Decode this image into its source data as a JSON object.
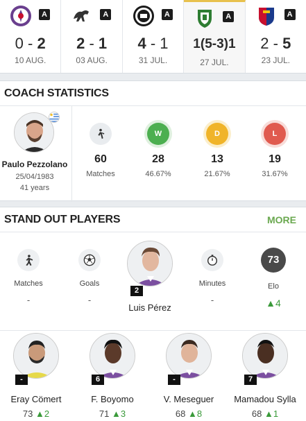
{
  "matches": [
    {
      "badge": "A",
      "score_left": "0",
      "score_right": "2",
      "bold_right": true,
      "date": "10 AUG."
    },
    {
      "badge": "A",
      "score_left": "2",
      "score_right": "1",
      "bold_right": false,
      "date": "03 AUG."
    },
    {
      "badge": "A",
      "score_left": "4",
      "score_right": "1",
      "bold_right": false,
      "date": "31 JUL."
    },
    {
      "badge": "A",
      "score_text": "1(5-3)1",
      "date": "27 JUL."
    },
    {
      "badge": "A",
      "score_left": "2",
      "score_right": "5",
      "bold_right": true,
      "date": "23 JUL."
    }
  ],
  "coach": {
    "section_title": "COACH STATISTICS",
    "name": "Paulo Pezzolano",
    "dob": "25/04/1983",
    "age": "41 years",
    "stats": [
      {
        "icon": "whistle-icon",
        "letter": "",
        "value": "60",
        "sub": "Matches",
        "color": "#e9ecef"
      },
      {
        "icon": "win-icon",
        "letter": "W",
        "value": "28",
        "sub": "46.67%",
        "color": "#4caf50"
      },
      {
        "icon": "draw-icon",
        "letter": "D",
        "value": "13",
        "sub": "21.67%",
        "color": "#f0b429"
      },
      {
        "icon": "loss-icon",
        "letter": "L",
        "value": "19",
        "sub": "31.67%",
        "color": "#e05a4f"
      }
    ]
  },
  "standout": {
    "section_title": "STAND OUT PLAYERS",
    "more_label": "MORE",
    "key": [
      {
        "label": "Matches",
        "value": "-"
      },
      {
        "label": "Goals",
        "value": "-"
      },
      {
        "label": "Minutes",
        "value": "-"
      },
      {
        "label": "Elo",
        "badge": "73",
        "value": "4"
      }
    ],
    "featured": {
      "number": "2",
      "name": "Luis Pérez"
    },
    "players": [
      {
        "tag": "-",
        "name": "Eray Cömert",
        "elo": "73",
        "delta": "2"
      },
      {
        "tag": "6",
        "name": "F. Boyomo",
        "elo": "71",
        "delta": "3"
      },
      {
        "tag": "-",
        "name": "V. Meseguer",
        "elo": "68",
        "delta": "8"
      },
      {
        "tag": "7",
        "name": "Mamadou Sylla",
        "elo": "68",
        "delta": "1"
      }
    ]
  },
  "colors": {
    "accent": "#6aa84f",
    "up": "#3a9a3a",
    "active_tab": "#e8c14d"
  }
}
